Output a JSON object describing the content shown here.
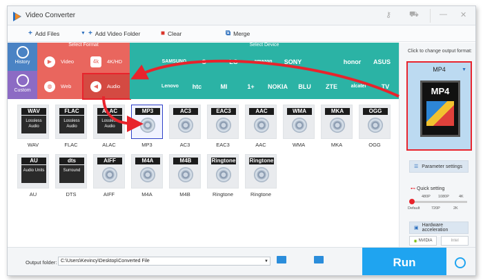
{
  "app": {
    "title": "Video Converter"
  },
  "toolbar": {
    "add_files": "Add Files",
    "add_video_folder": "Add Video Folder",
    "clear": "Clear",
    "merge": "Merge"
  },
  "category": {
    "history": "History",
    "custom": "Custom",
    "select_format": "Select Format",
    "select_device": "Select Device",
    "video": "Video",
    "hd": "4K/HD",
    "web": "Web",
    "audio": "Audio",
    "brands_row1": [
      "",
      "SAMSUNG",
      "G",
      "LG",
      "amazon",
      "SONY",
      "",
      "honor",
      "ASUS"
    ],
    "brands_row2": [
      "",
      "Lenovo",
      "htc",
      "MI",
      "1+",
      "NOKIA",
      "BLU",
      "ZTE",
      "alcatel",
      "TV"
    ]
  },
  "formats": [
    {
      "name": "WAV",
      "badge": "WAV",
      "sub": "Lossless Audio"
    },
    {
      "name": "FLAC",
      "badge": "FLAC",
      "sub": "Lossless Audio"
    },
    {
      "name": "ALAC",
      "badge": "ALAC",
      "sub": "Lossless Audio"
    },
    {
      "name": "MP3",
      "badge": "MP3",
      "sub": ""
    },
    {
      "name": "AC3",
      "badge": "AC3",
      "sub": ""
    },
    {
      "name": "EAC3",
      "badge": "EAC3",
      "sub": ""
    },
    {
      "name": "AAC",
      "badge": "AAC",
      "sub": ""
    },
    {
      "name": "WMA",
      "badge": "WMA",
      "sub": ""
    },
    {
      "name": "MKA",
      "badge": "MKA",
      "sub": ""
    },
    {
      "name": "OGG",
      "badge": "OGG",
      "sub": ""
    },
    {
      "name": "AU",
      "badge": "AU",
      "sub": "Audio Units"
    },
    {
      "name": "DTS",
      "badge": "dts",
      "sub": "Surround"
    },
    {
      "name": "AIFF",
      "badge": "AIFF",
      "sub": ""
    },
    {
      "name": "M4A",
      "badge": "M4A",
      "sub": ""
    },
    {
      "name": "M4B",
      "badge": "M4B",
      "sub": ""
    },
    {
      "name": "Ringtone",
      "badge": "Ringtone",
      "sub": ""
    },
    {
      "name": "Ringtone",
      "badge": "Ringtone",
      "sub": ""
    }
  ],
  "selected_format": "MP3",
  "right_panel": {
    "click_label": "Click to change output format:",
    "output_format": "MP4",
    "icon_text": "MP4",
    "parameter_settings": "Parameter settings",
    "quick_setting": "Quick setting",
    "ticks_top": [
      "480P",
      "1080P",
      "4K"
    ],
    "ticks_bottom": [
      "Default",
      "720P",
      "2K"
    ],
    "quality_fraction": 0.0,
    "hardware_acceleration": "Hardware acceleration",
    "nvidia": "NVIDIA",
    "intel": "Intel"
  },
  "bottom": {
    "output_folder_label": "Output folder:",
    "output_folder_value": "C:\\Users\\Kevincy\\Desktop\\Converted File",
    "run": "Run"
  },
  "colors": {
    "format_panel": "#e9665e",
    "device_panel": "#2bb3a5",
    "run": "#1fa4f0",
    "annotation": "#e8232c"
  }
}
